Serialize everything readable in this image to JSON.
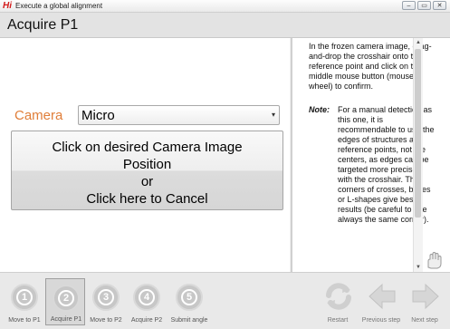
{
  "window": {
    "logo": "Hi",
    "title": "Execute a global alignment",
    "buttons": [
      "–",
      "▭",
      "✕"
    ]
  },
  "header": {
    "title": "Acquire P1"
  },
  "camera": {
    "label": "Camera",
    "selected": "Micro"
  },
  "action_button": {
    "line1": "Click on desired Camera Image",
    "line2": "Position",
    "line3": "or",
    "line4": "Click here to Cancel"
  },
  "help": {
    "text": "In the frozen camera image, drag-and-drop the crosshair onto the reference point and click on the middle mouse button (mouse wheel) to confirm.",
    "note_label": "Note:",
    "note_text": "For a manual detection as this one, it is recommendable to use the edges of structures as reference points, not the centers, as edges can be targeted more precisely with the crosshair. The corners of crosses, boxes or L-shapes give best results (be careful to use always the same corner)."
  },
  "steps": [
    {
      "number": "1",
      "label": "Move to P1",
      "active": false
    },
    {
      "number": "2",
      "label": "Acquire P1",
      "active": true
    },
    {
      "number": "3",
      "label": "Move to P2",
      "active": false
    },
    {
      "number": "4",
      "label": "Acquire P2",
      "active": false
    },
    {
      "number": "5",
      "label": "Submit angle",
      "active": false
    }
  ],
  "nav": {
    "restart": "Restart",
    "previous": "Previous step",
    "next": "Next step"
  },
  "colors": {
    "camera_label": "#e07e39",
    "logo": "#d31d1d"
  }
}
